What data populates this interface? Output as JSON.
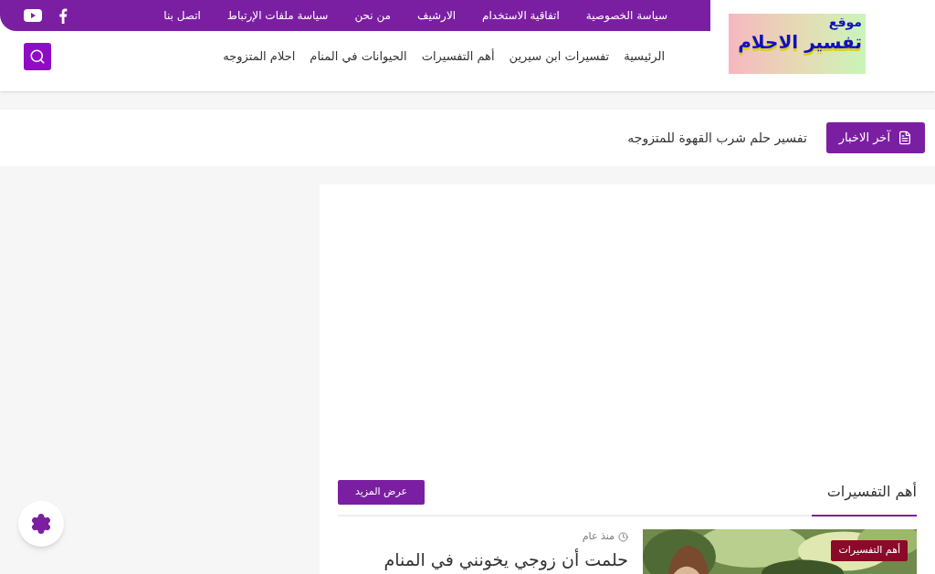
{
  "logo": {
    "top": "موقع",
    "main": "تفسير الاحلام"
  },
  "top_links": [
    "سياسة الخصوصية",
    "اتفاقية الاستخدام",
    "الارشيف",
    "من نحن",
    "سياسة ملفات الإرتباط",
    "اتصل بنا"
  ],
  "nav": [
    "الرئيسية",
    "تفسيرات ابن سيرين",
    "أهم التفسيرات",
    "الحيوانات في المنام",
    "احلام المتزوجه"
  ],
  "ticker": {
    "label": "آخر الاخبار",
    "headline": "تفسير حلم شرب القهوة للمتزوجه"
  },
  "section": {
    "title": "أهم التفسيرات",
    "more": "عرض المزيد"
  },
  "posts": [
    {
      "kind": "picture",
      "time": "منذ عام",
      "title": "حلمت أن زوجي يخونني في المنام",
      "category": "أهم التفسيرات"
    }
  ]
}
